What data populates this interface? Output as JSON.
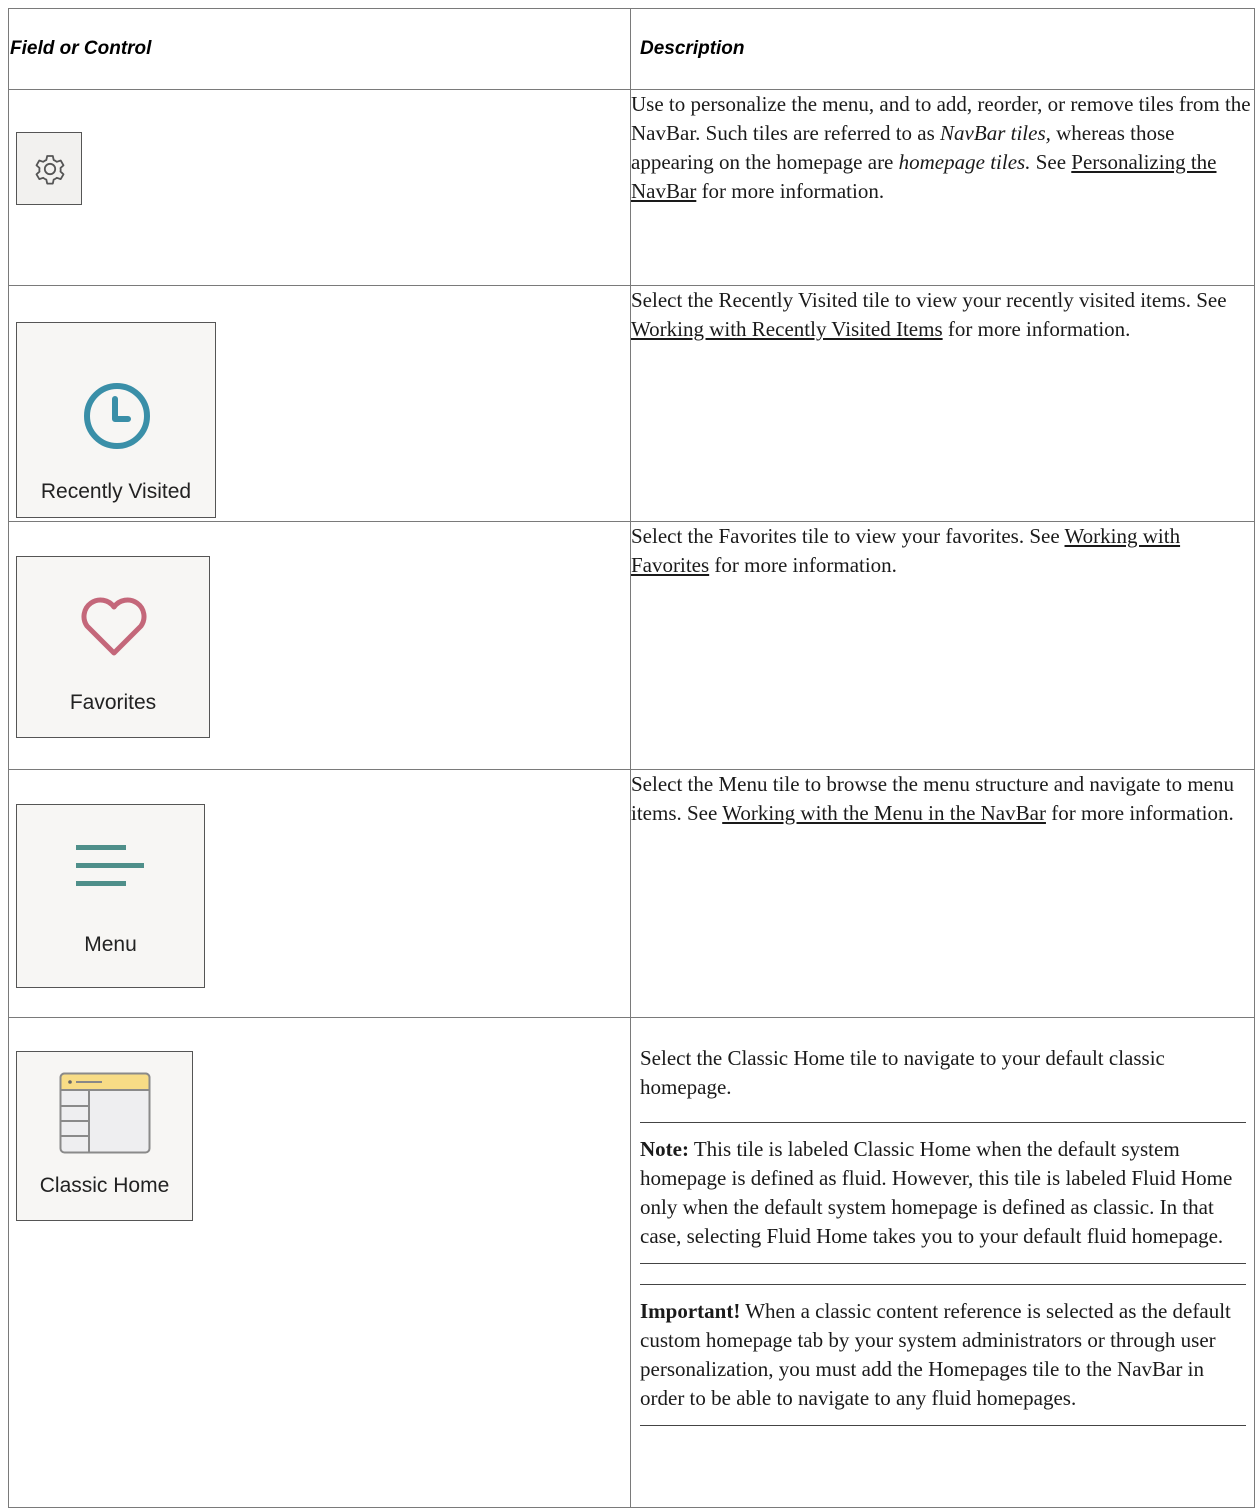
{
  "header": {
    "col1": "Field or Control",
    "col2": "Description"
  },
  "rows": [
    {
      "tile": {
        "icon": "gear-icon",
        "label": ""
      },
      "desc": {
        "p1": "Use to personalize the menu, and to add, reorder, or remove tiles from the NavBar. Such tiles are referred to as ",
        "em1": "NavBar tiles,",
        "p2": " whereas those appearing on the homepage are ",
        "em2": "homepage tiles.",
        "p3": " See ",
        "link": "Personalizing the NavBar",
        "p4": " for more information."
      }
    },
    {
      "tile": {
        "icon": "clock-icon",
        "label": "Recently Visited"
      },
      "desc": {
        "p1": "Select the Recently Visited tile to view your recently visited items. See ",
        "link": "Working with Recently Visited Items",
        "p2": " for more information."
      }
    },
    {
      "tile": {
        "icon": "heart-icon",
        "label": "Favorites"
      },
      "desc": {
        "p1": "Select the Favorites tile to view your favorites. See ",
        "link": "Working with Favorites",
        "p2": " for more information."
      }
    },
    {
      "tile": {
        "icon": "menu-lines-icon",
        "label": "Menu"
      },
      "desc": {
        "p1": "Select the Menu tile to browse the menu structure and navigate to menu items. See ",
        "link": "Working with the Menu in the NavBar",
        "p2": " for more information."
      }
    },
    {
      "tile": {
        "icon": "classic-home-icon",
        "label": "Classic Home"
      },
      "desc": {
        "p1": "Select the Classic Home tile to navigate to your default classic homepage."
      },
      "note": {
        "label": "Note:",
        "text": " This tile is labeled Classic Home when the default system homepage is defined as fluid. However, this tile is labeled Fluid Home only when the default system homepage is defined as classic. In that case, selecting Fluid Home takes you to your default fluid homepage."
      },
      "important": {
        "label": "Important!",
        "text": " When a classic content reference is selected as the default custom homepage tab by your system administrators or through user personalization, you must add the Homepages tile to the NavBar in order to be able to navigate to any fluid homepages."
      }
    }
  ],
  "colors": {
    "clock": "#3a8fa8",
    "heart": "#c4677a",
    "menu": "#4f8f8a",
    "classic_header": "#f7dc86",
    "tile_bg": "#f7f6f4"
  }
}
